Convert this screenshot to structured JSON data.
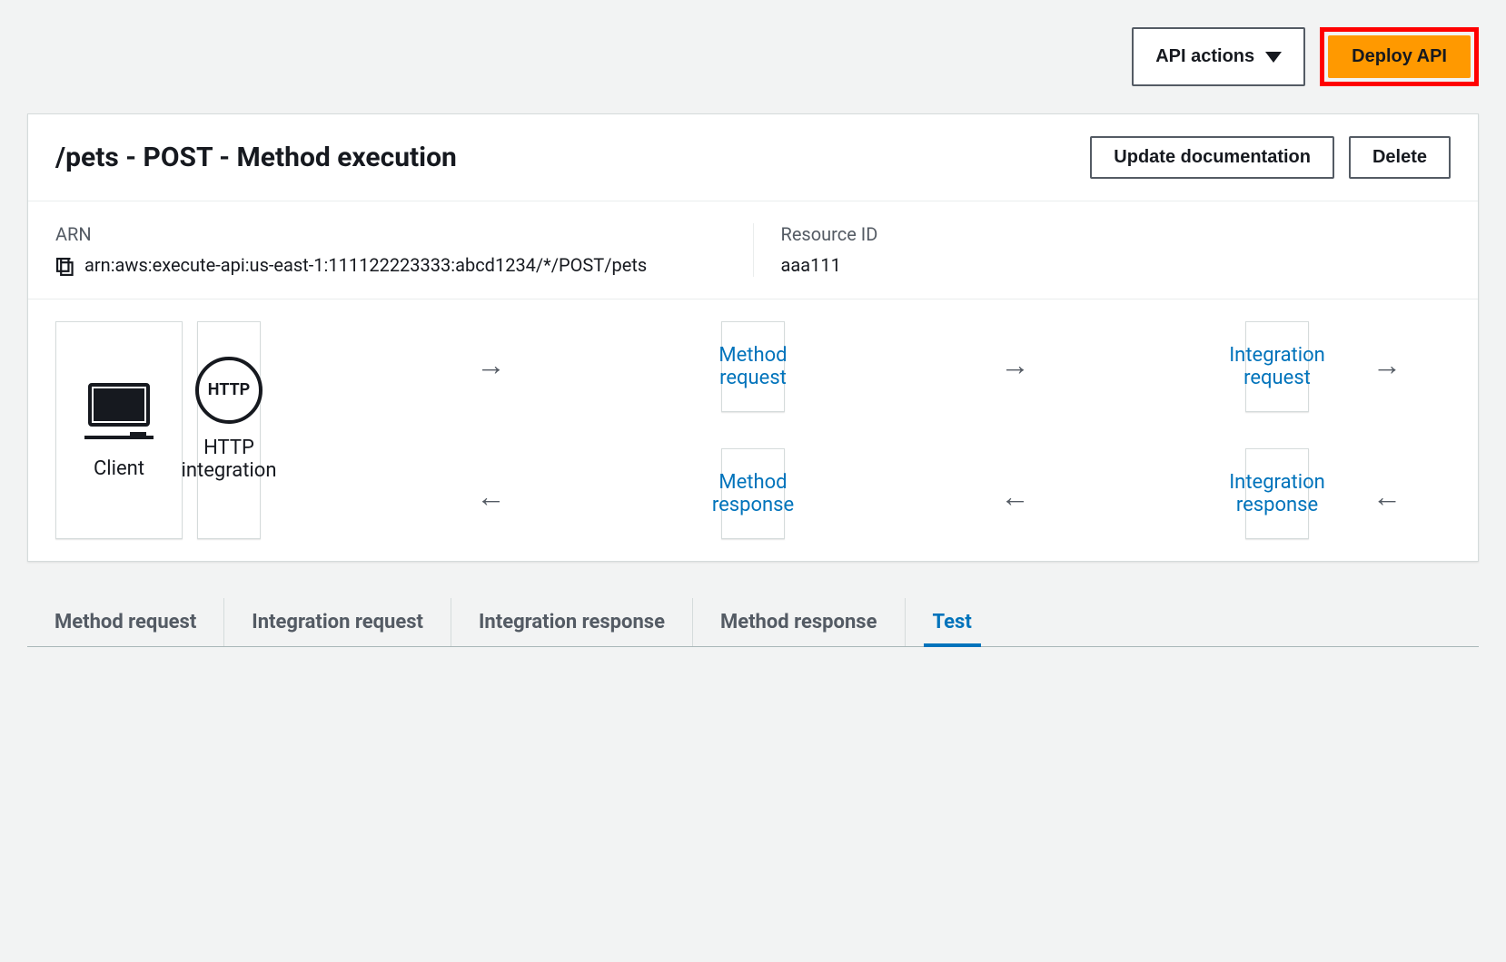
{
  "topActions": {
    "apiActionsLabel": "API actions",
    "deployLabel": "Deploy API"
  },
  "panel": {
    "title": "/pets - POST - Method execution",
    "updateDocLabel": "Update documentation",
    "deleteLabel": "Delete"
  },
  "info": {
    "arnLabel": "ARN",
    "arnValue": "arn:aws:execute-api:us-east-1:111122223333:abcd1234/*/POST/pets",
    "resourceIdLabel": "Resource ID",
    "resourceIdValue": "aaa111"
  },
  "flow": {
    "clientLabel": "Client",
    "methodRequest": "Method request",
    "integrationRequest": "Integration request",
    "methodResponse": "Method response",
    "integrationResponse": "Integration response",
    "httpBadge": "HTTP",
    "httpLabel": "HTTP integration"
  },
  "tabs": {
    "items": [
      {
        "label": "Method request"
      },
      {
        "label": "Integration request"
      },
      {
        "label": "Integration response"
      },
      {
        "label": "Method response"
      },
      {
        "label": "Test"
      }
    ]
  }
}
